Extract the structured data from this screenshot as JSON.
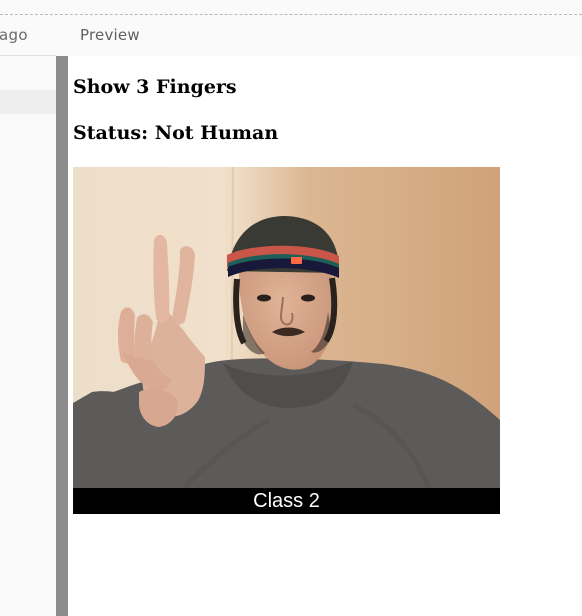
{
  "tabs": {
    "left_partial_label": "ago",
    "preview_label": "Preview"
  },
  "preview": {
    "instruction": "Show 3 Fingers",
    "status": "Status: Not Human",
    "video_caption": "Class 2"
  }
}
